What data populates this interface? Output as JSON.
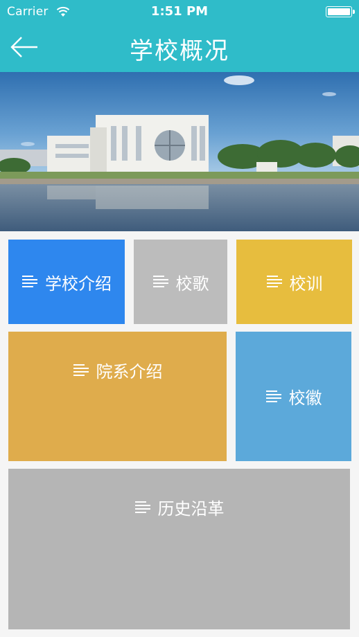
{
  "status_bar": {
    "carrier": "Carrier",
    "time": "1:51 PM"
  },
  "nav": {
    "title": "学校概况",
    "back_icon": "arrow-left-icon"
  },
  "colors": {
    "header": "#2fbcc9",
    "tile_intro": "#2e87ee",
    "tile_song": "#bcbcbc",
    "tile_motto": "#e7bd3e",
    "tile_depts": "#dfac4c",
    "tile_emblem": "#5ca9da",
    "tile_history": "#b5b5b5"
  },
  "tiles": [
    {
      "label": "学校介绍",
      "icon": "list-lines-icon"
    },
    {
      "label": "校歌",
      "icon": "list-lines-icon"
    },
    {
      "label": "校训",
      "icon": "list-lines-icon"
    },
    {
      "label": "院系介绍",
      "icon": "list-lines-icon"
    },
    {
      "label": "校徽",
      "icon": "list-lines-icon"
    },
    {
      "label": "历史沿革",
      "icon": "list-lines-icon"
    }
  ]
}
